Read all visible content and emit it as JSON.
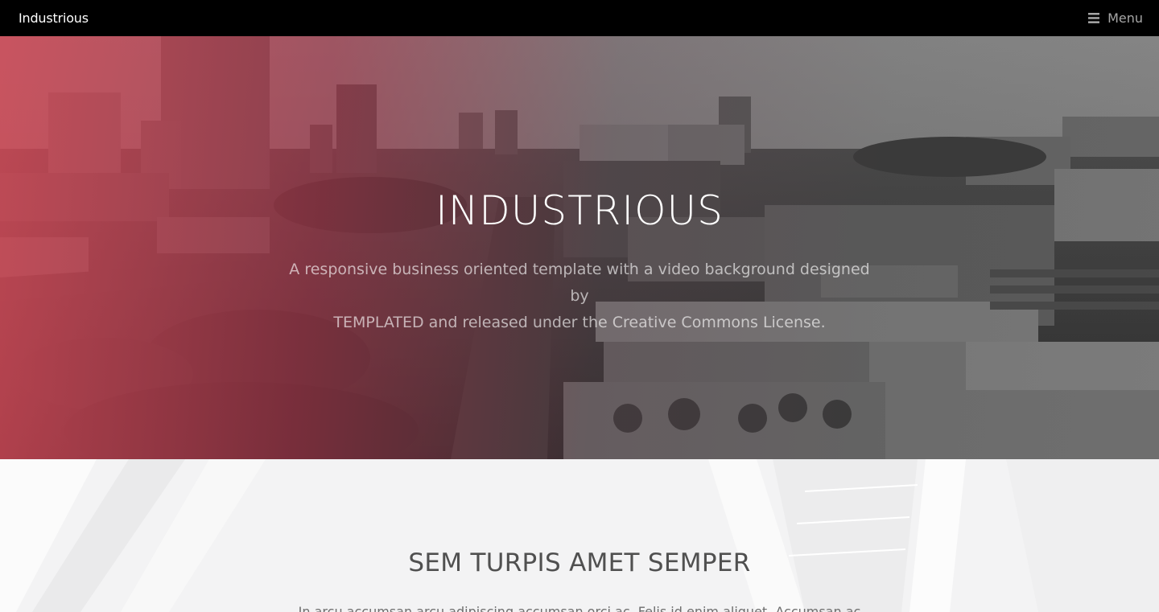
{
  "header": {
    "logo": "Industrious",
    "menu_label": "Menu",
    "menu_icon": "hamburger-icon"
  },
  "banner": {
    "title": "INDUSTRIOUS",
    "text_line1": "A responsive business oriented template with a video background designed by",
    "text_line2": "TEMPLATED and released under the Creative Commons License."
  },
  "section": {
    "title": "SEM TURPIS AMET SEMPER",
    "text": "In arcu accumsan arcu adipiscing accumsan orci ac. Felis id enim aliquet. Accumsan ac"
  },
  "colors": {
    "header_bg": "#000000",
    "accent_red": "#d64856",
    "section_bg": "#f3f3f4"
  }
}
